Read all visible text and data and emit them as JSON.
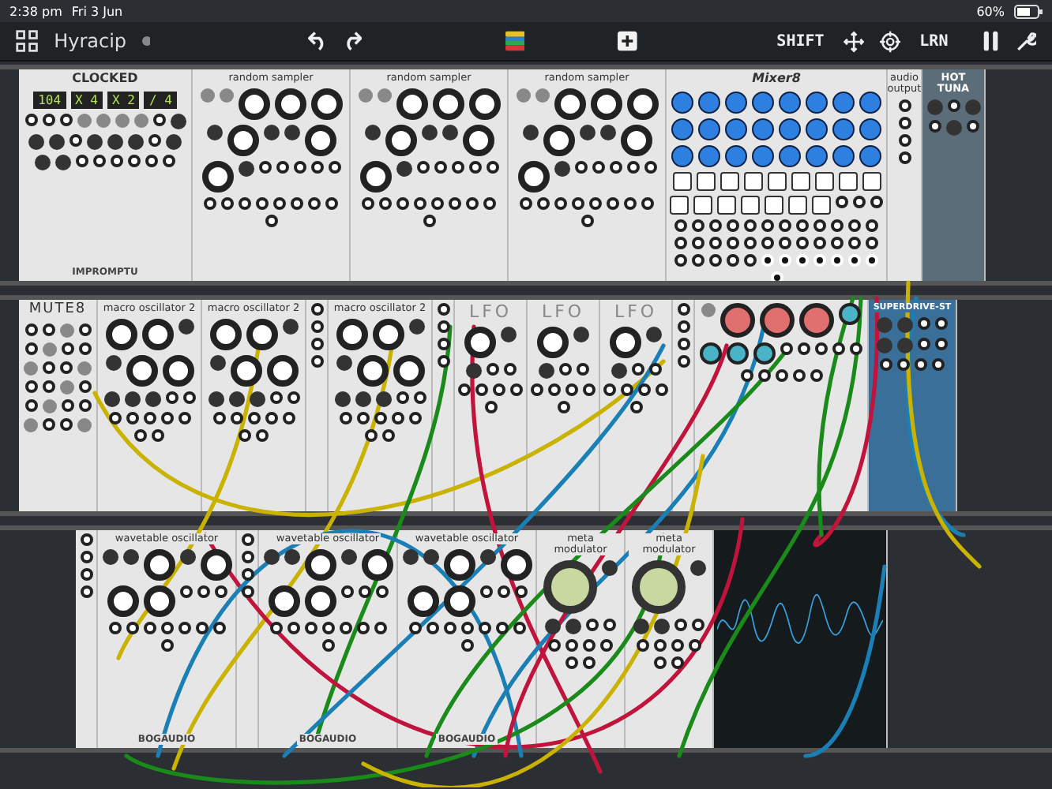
{
  "status_bar": {
    "time": "2:38 pm",
    "date": "Fri 3 Jun",
    "battery": "60%"
  },
  "toolbar": {
    "patch_name": "Hyracip",
    "shift": "SHIFT",
    "learn": "LRN"
  },
  "rows": [
    {
      "modules": [
        {
          "title": "CLOCKED",
          "kind": "clock",
          "displays": [
            "104",
            "X 4",
            "X 2",
            "/ 4"
          ],
          "brand": "IMPROMPTU"
        },
        {
          "title": "random sampler",
          "kind": "sampler"
        },
        {
          "title": "random sampler",
          "kind": "sampler"
        },
        {
          "title": "random sampler",
          "kind": "sampler"
        },
        {
          "title": "Mixer8",
          "kind": "mixer"
        },
        {
          "title": "audio output",
          "kind": "audio"
        },
        {
          "title": "HOT TUNA",
          "kind": "tuna"
        }
      ]
    },
    {
      "modules": [
        {
          "title": "MUTE8",
          "kind": "mute"
        },
        {
          "title": "macro oscillator 2",
          "kind": "macro"
        },
        {
          "title": "macro oscillator 2",
          "kind": "macro"
        },
        {
          "kind": "blank"
        },
        {
          "title": "macro oscillator 2",
          "kind": "macro"
        },
        {
          "kind": "blank"
        },
        {
          "title": "LFO",
          "kind": "lfo"
        },
        {
          "title": "LFO",
          "kind": "lfo"
        },
        {
          "title": "LFO",
          "kind": "lfo"
        },
        {
          "kind": "blank"
        },
        {
          "kind": "clouds"
        },
        {
          "title": "SUPERDRIVE-ST",
          "kind": "drive"
        }
      ]
    },
    {
      "modules": [
        {
          "kind": "blank"
        },
        {
          "title": "wavetable oscillator",
          "kind": "wavetable",
          "brand": "BOGAUDIO"
        },
        {
          "kind": "blank"
        },
        {
          "title": "wavetable oscillator",
          "kind": "wavetable",
          "brand": "BOGAUDIO"
        },
        {
          "title": "wavetable oscillator",
          "kind": "wavetable",
          "brand": "BOGAUDIO"
        },
        {
          "title": "meta modulator",
          "kind": "meta"
        },
        {
          "title": "meta modulator",
          "kind": "meta"
        },
        {
          "kind": "scope"
        }
      ]
    }
  ]
}
